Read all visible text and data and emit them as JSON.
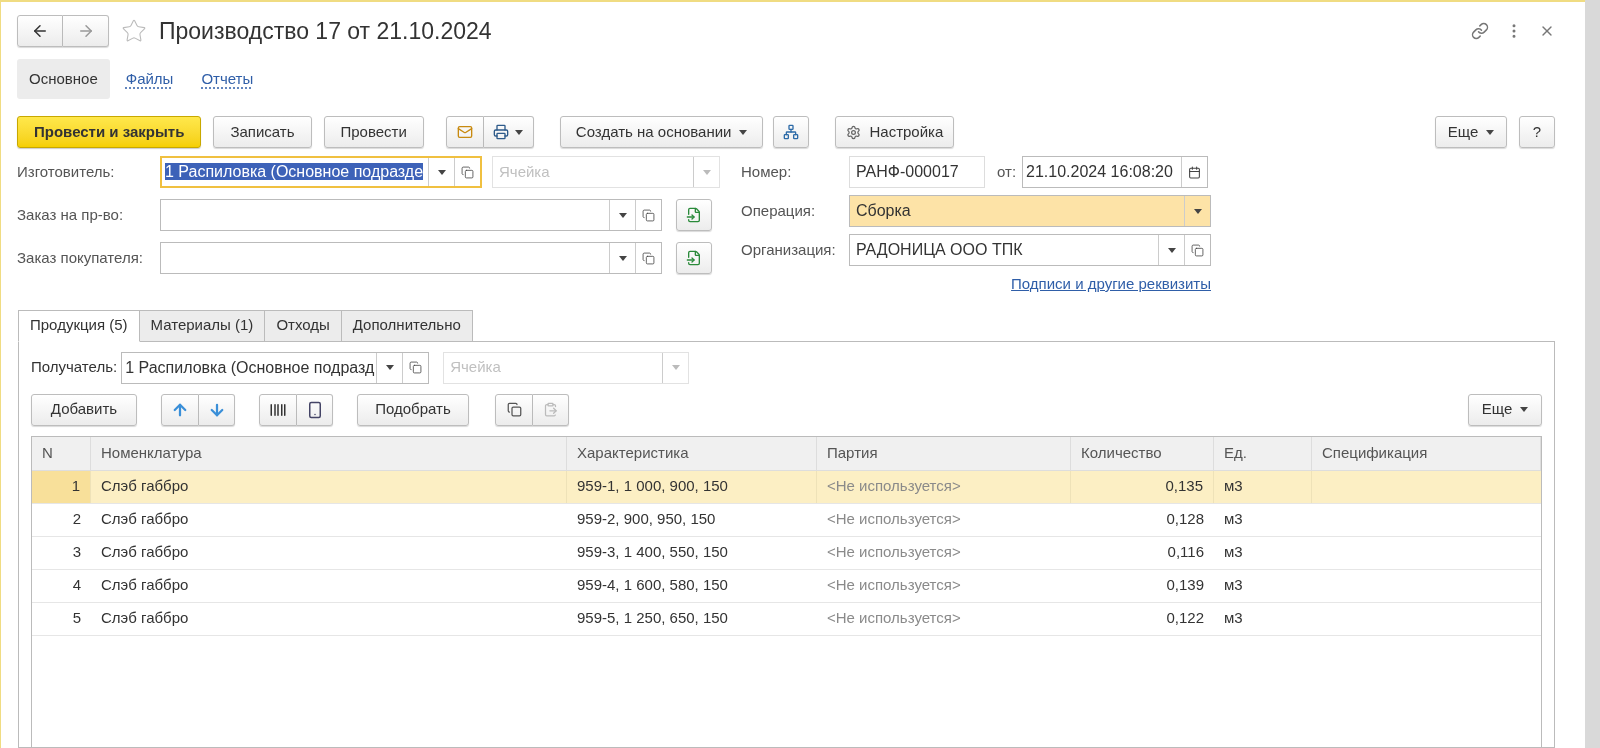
{
  "header": {
    "title": "Производство 17 от 21.10.2024"
  },
  "sections": [
    {
      "label": "Основное",
      "selected": true
    },
    {
      "label": "Файлы",
      "selected": false
    },
    {
      "label": "Отчеты",
      "selected": false
    }
  ],
  "toolbar": {
    "buttons": [
      {
        "kind": "primary",
        "label": "Провести и закрыть"
      },
      {
        "kind": "plain",
        "label": "Записать"
      },
      {
        "kind": "plain",
        "label": "Провести"
      },
      {
        "kind": "mail-print"
      },
      {
        "kind": "dropdown",
        "label": "Создать на основании"
      },
      {
        "kind": "structure"
      },
      {
        "kind": "settings",
        "label": "Настройка"
      }
    ],
    "more": "Еще",
    "help": "?"
  },
  "left_fields": [
    {
      "label": "Изготовитель:",
      "value": "1 Распиловка (Основное подразде",
      "focused": true,
      "cell": {
        "placeholder": "Ячейка",
        "disabled": true
      }
    },
    {
      "label": "Заказ на пр-во:",
      "focused": false,
      "fill_button": true
    },
    {
      "label": "Заказ покупателя:",
      "focused": false,
      "fill_button": true
    }
  ],
  "number": {
    "label": "Номер:",
    "value": "РАНФ-000017",
    "date_label": "от:",
    "date": "21.10.2024 16:08:20"
  },
  "operation": {
    "label": "Операция:",
    "value": "Сборка",
    "highlighted": true
  },
  "organization": {
    "label": "Организация:",
    "value": "РАДОНИЦА ООО ТПК"
  },
  "details_link": "Подписи и другие реквизиты",
  "tabs": [
    {
      "label": "Продукция (5)",
      "selected": true
    },
    {
      "label": "Материалы (1)",
      "selected": false
    },
    {
      "label": "Отходы",
      "selected": false
    },
    {
      "label": "Дополнительно",
      "selected": false
    }
  ],
  "recipient": {
    "label": "Получатель:",
    "value": "1 Распиловка (Основное подразд",
    "cell": {
      "placeholder": "Ячейка",
      "disabled": true
    }
  },
  "table_toolbar": {
    "add": "Добавить",
    "pick": "Подобрать",
    "more": "Еще"
  },
  "table": {
    "columns": [
      "N",
      "Номенклатура",
      "Характеристика",
      "Партия",
      "Количество",
      "Ед.",
      "Спецификация"
    ],
    "rows": [
      {
        "n": "1",
        "item": "Слэб габбро",
        "characteristic": "959-1, 1 000, 900, 150",
        "batch": "<Не используется>",
        "quantity": "0,135",
        "unit": "м3",
        "selected": true
      },
      {
        "n": "2",
        "item": "Слэб габбро",
        "characteristic": "959-2, 900, 950, 150",
        "batch": "<Не используется>",
        "quantity": "0,128",
        "unit": "м3",
        "selected": false
      },
      {
        "n": "3",
        "item": "Слэб габбро",
        "characteristic": "959-3, 1 400, 550, 150",
        "batch": "<Не используется>",
        "quantity": "0,116",
        "unit": "м3",
        "selected": false
      },
      {
        "n": "4",
        "item": "Слэб габбро",
        "characteristic": "959-4, 1 600, 580, 150",
        "batch": "<Не используется>",
        "quantity": "0,139",
        "unit": "м3",
        "selected": false
      },
      {
        "n": "5",
        "item": "Слэб габбро",
        "characteristic": "959-5, 1 250, 650, 150",
        "batch": "<Не используется>",
        "quantity": "0,122",
        "unit": "м3",
        "selected": false
      }
    ]
  }
}
